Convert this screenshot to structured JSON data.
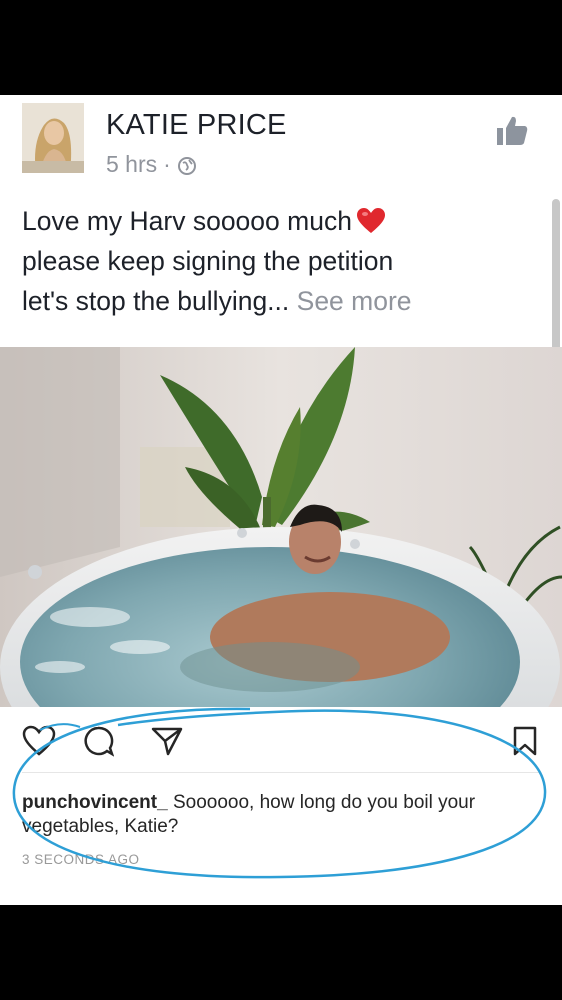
{
  "post": {
    "author": "KATIE PRICE",
    "time": "5 hrs",
    "separator": "·",
    "text_line1": "Love my Harv sooooo much",
    "text_line2": "please keep signing the petition",
    "text_line3": "let's stop the bullying...",
    "see_more": "See more",
    "icons": {
      "globe": "globe-icon",
      "like": "thumbs-up-icon",
      "heart": "red-heart-emoji"
    }
  },
  "instagram": {
    "icons": [
      "heart-icon",
      "comment-icon",
      "share-icon",
      "bookmark-icon"
    ],
    "comment_user": "punchovincent_",
    "comment_text": "Soooooo, how long do you boil your vegetables, Katie?",
    "timestamp": "3 SECONDS AGO"
  },
  "colors": {
    "text": "#1d2129",
    "meta": "#90949c",
    "heart_red": "#e0282e",
    "annotation_blue": "#2e9fd6"
  }
}
